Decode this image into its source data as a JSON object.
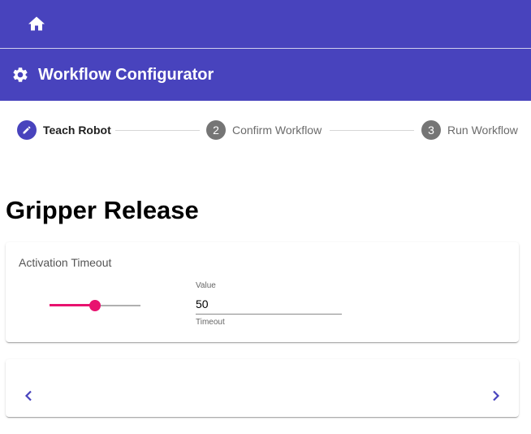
{
  "header": {
    "home_icon": "home-icon",
    "title": "Workflow Configurator",
    "title_icon": "gear-icon",
    "color": "#4843bd"
  },
  "stepper": {
    "steps": [
      {
        "marker": "",
        "icon": "pencil-icon",
        "label": "Teach Robot",
        "state": "active"
      },
      {
        "marker": "2",
        "label": "Confirm Workflow",
        "state": "inactive"
      },
      {
        "marker": "3",
        "label": "Run Workflow",
        "state": "inactive"
      }
    ]
  },
  "page": {
    "title": "Gripper Release"
  },
  "timeout_card": {
    "heading": "Activation Timeout",
    "slider": {
      "min": 0,
      "max": 100,
      "value": 50,
      "color": "#e8126f"
    },
    "field": {
      "label": "Value",
      "value": "50",
      "hint": "Timeout"
    }
  },
  "navigation": {
    "prev_icon": "chevron-left-icon",
    "next_icon": "chevron-right-icon"
  }
}
